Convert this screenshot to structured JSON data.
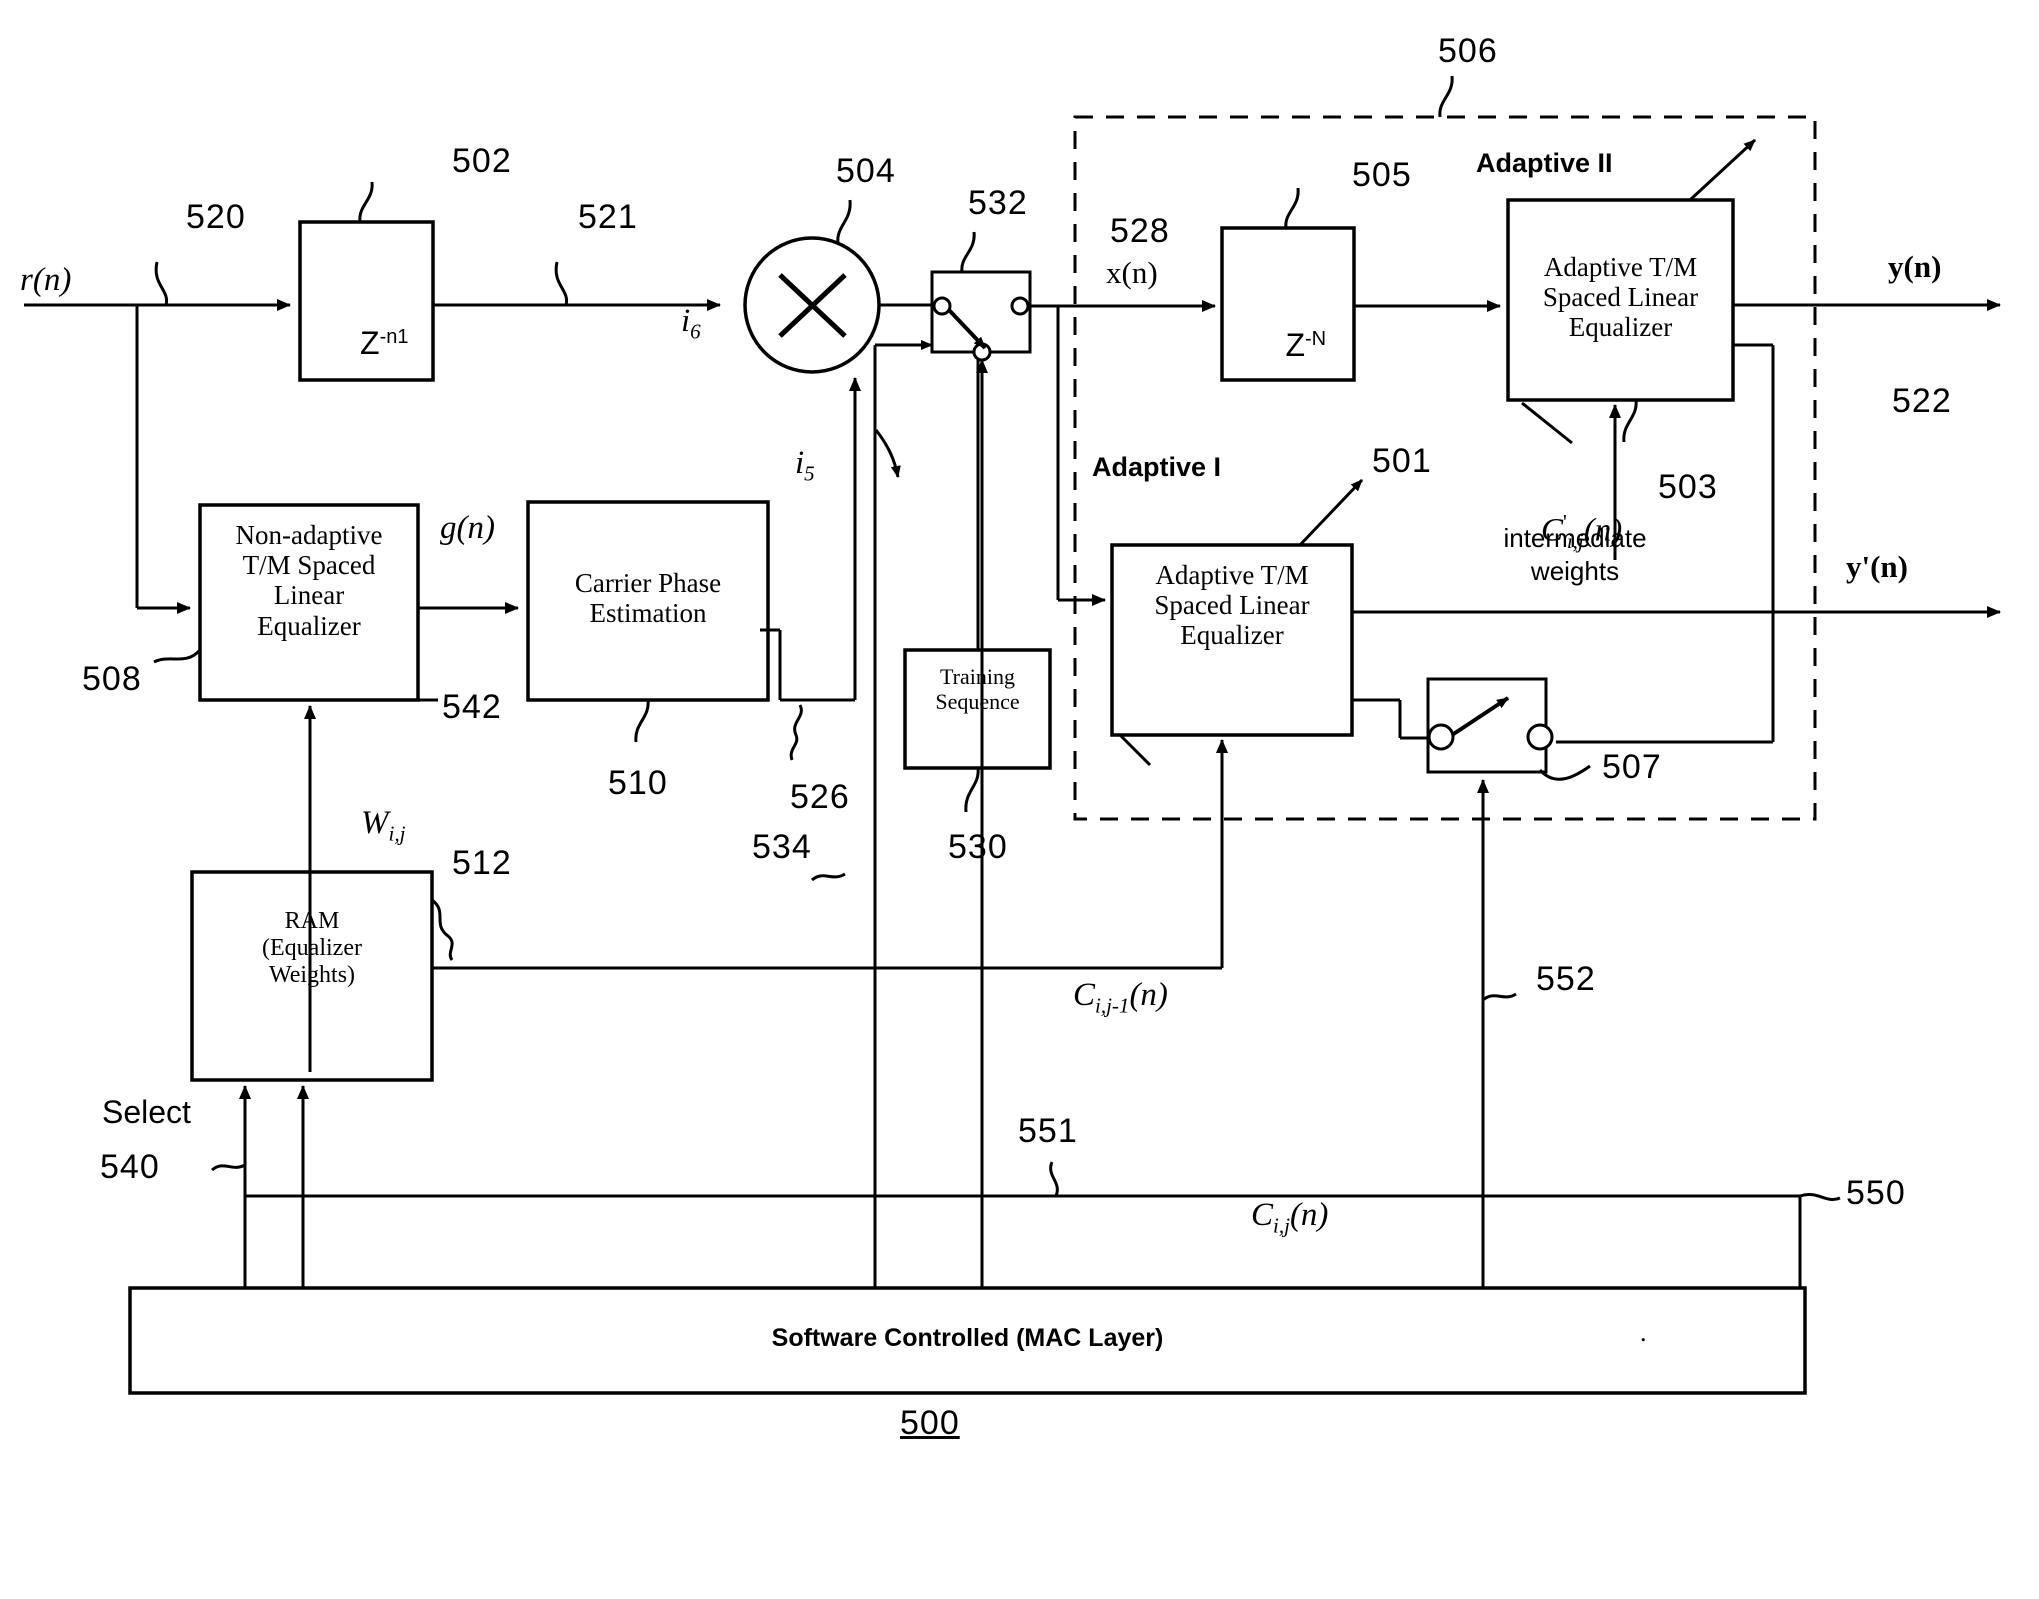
{
  "figure": {
    "number": "500",
    "caption": "500"
  },
  "signals": {
    "input": "r(n)",
    "tap_520": "520",
    "after_delay": "521",
    "i6": "i",
    "i6_sub": "6",
    "i5": "i",
    "i5_sub": "5",
    "g_of_n": "g(n)",
    "x_of_n": "x(n)",
    "x_ref": "528",
    "y_of_n": "y(n)",
    "y_prime_of_n": "y'(n)",
    "y_ref": "522",
    "w_weights": "W",
    "w_sub": "i,j",
    "c_ij_n": "C",
    "c_ij_sub": "i,j",
    "c_ij_arg": "(n)",
    "c_ij_prime": "C",
    "c_ij_prime_sup": "'",
    "c_ij_prime_sub": "i,j",
    "c_ij_prime_arg": "(n)",
    "c_ijm1": "C",
    "c_ijm1_sub": "i,j-1",
    "c_ijm1_arg": "(n)",
    "intermediate_weights": "intermediate\nweights",
    "select": "Select"
  },
  "blocks": {
    "delay_n1": {
      "label": "Z",
      "exp": "-n1",
      "ref": "502"
    },
    "nonadaptive_eq": {
      "label": "Non-adaptive\nT/M Spaced\nLinear\nEqualizer",
      "ref": "508",
      "out_ref": "542"
    },
    "carrier_phase": {
      "label": "Carrier Phase\nEstimation",
      "ref": "510"
    },
    "ram": {
      "label": "RAM\n(Equalizer\nWeights)",
      "ref": "512"
    },
    "multiplier": {
      "label": "×",
      "ref": "504"
    },
    "switch_532": {
      "ref": "532"
    },
    "training_sequence": {
      "label": "Training\nSequence",
      "ref": "530"
    },
    "delay_N": {
      "label": "Z",
      "exp": "-N",
      "ref": "505"
    },
    "adaptive_eq_1": {
      "label": "Adaptive T/M\nSpaced Linear\nEqualizer",
      "ref": "501"
    },
    "adaptive_eq_2": {
      "label": "Adaptive T/M\nSpaced Linear\nEqualizer",
      "ref": "503"
    },
    "switch_507": {
      "ref": "507"
    },
    "mac_layer": {
      "label": "Software Controlled (MAC Layer)"
    }
  },
  "groups": {
    "adaptive_one": "Adaptive I",
    "adaptive_two": "Adaptive II",
    "adaptive_two_ref": "506"
  },
  "refs": {
    "r520": "520",
    "r521": "521",
    "r502": "502",
    "r504": "504",
    "r532": "532",
    "r528": "528",
    "r505": "505",
    "r506": "506",
    "r501": "501",
    "r503": "503",
    "r507": "507",
    "r508": "508",
    "r510": "510",
    "r512": "512",
    "r522": "522",
    "r526": "526",
    "r530": "530",
    "r534": "534",
    "r540": "540",
    "r542": "542",
    "r550": "550",
    "r551": "551",
    "r552": "552"
  },
  "colors": {
    "ink": "#000000",
    "paper": "#ffffff"
  }
}
